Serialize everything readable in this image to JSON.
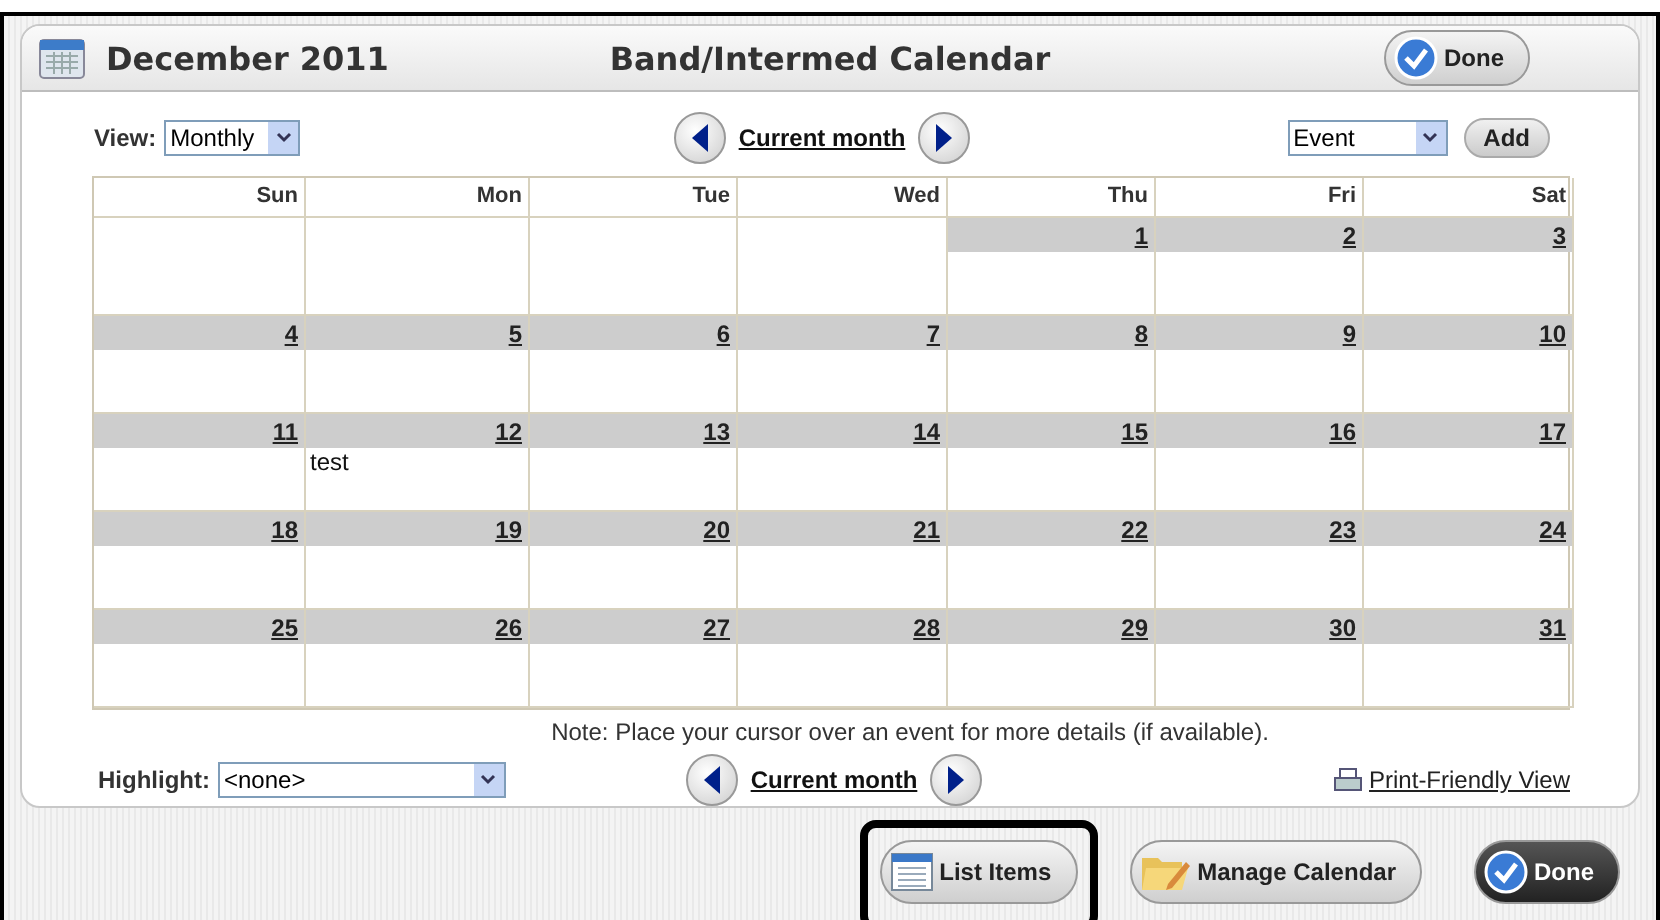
{
  "header": {
    "month": "December 2011",
    "title": "Band/Intermed Calendar",
    "done": "Done"
  },
  "toolbar": {
    "view_label": "View:",
    "view_value": "Monthly",
    "nav_label": "Current month",
    "add_type": "Event",
    "add": "Add"
  },
  "weekdays": [
    "Sun",
    "Mon",
    "Tue",
    "Wed",
    "Thu",
    "Fri",
    "Sat"
  ],
  "weeks": [
    [
      {
        "kind": "blank"
      },
      {
        "kind": "blank"
      },
      {
        "kind": "blank"
      },
      {
        "kind": "blank"
      },
      {
        "kind": "day",
        "date": "1"
      },
      {
        "kind": "day",
        "date": "2"
      },
      {
        "kind": "day",
        "date": "3"
      }
    ],
    [
      {
        "kind": "day",
        "date": "4"
      },
      {
        "kind": "day",
        "date": "5"
      },
      {
        "kind": "day",
        "date": "6"
      },
      {
        "kind": "day",
        "date": "7"
      },
      {
        "kind": "day",
        "date": "8"
      },
      {
        "kind": "day",
        "date": "9"
      },
      {
        "kind": "day",
        "date": "10"
      }
    ],
    [
      {
        "kind": "day",
        "date": "11"
      },
      {
        "kind": "day",
        "date": "12",
        "events": [
          "test"
        ]
      },
      {
        "kind": "day",
        "date": "13"
      },
      {
        "kind": "day",
        "date": "14"
      },
      {
        "kind": "day",
        "date": "15"
      },
      {
        "kind": "day",
        "date": "16"
      },
      {
        "kind": "day",
        "date": "17"
      }
    ],
    [
      {
        "kind": "day",
        "date": "18"
      },
      {
        "kind": "day",
        "date": "19"
      },
      {
        "kind": "day",
        "date": "20"
      },
      {
        "kind": "day",
        "date": "21"
      },
      {
        "kind": "day",
        "date": "22"
      },
      {
        "kind": "day",
        "date": "23"
      },
      {
        "kind": "day",
        "date": "24"
      }
    ],
    [
      {
        "kind": "day",
        "date": "25"
      },
      {
        "kind": "day",
        "date": "26"
      },
      {
        "kind": "day",
        "date": "27"
      },
      {
        "kind": "day",
        "date": "28"
      },
      {
        "kind": "day",
        "date": "29"
      },
      {
        "kind": "day",
        "date": "30"
      },
      {
        "kind": "day",
        "date": "31"
      }
    ]
  ],
  "note": "Note: Place your cursor over an event for more details (if available).",
  "footer": {
    "highlight_label": "Highlight:",
    "highlight_value": "<none>",
    "nav_label": "Current month",
    "print": "Print-Friendly View"
  },
  "actions": [
    {
      "label": "List Items",
      "kind": "list",
      "highlighted": true
    },
    {
      "label": "Manage Calendar",
      "kind": "manage",
      "highlighted": false
    },
    {
      "label": "Done",
      "kind": "done",
      "highlighted": false
    }
  ]
}
